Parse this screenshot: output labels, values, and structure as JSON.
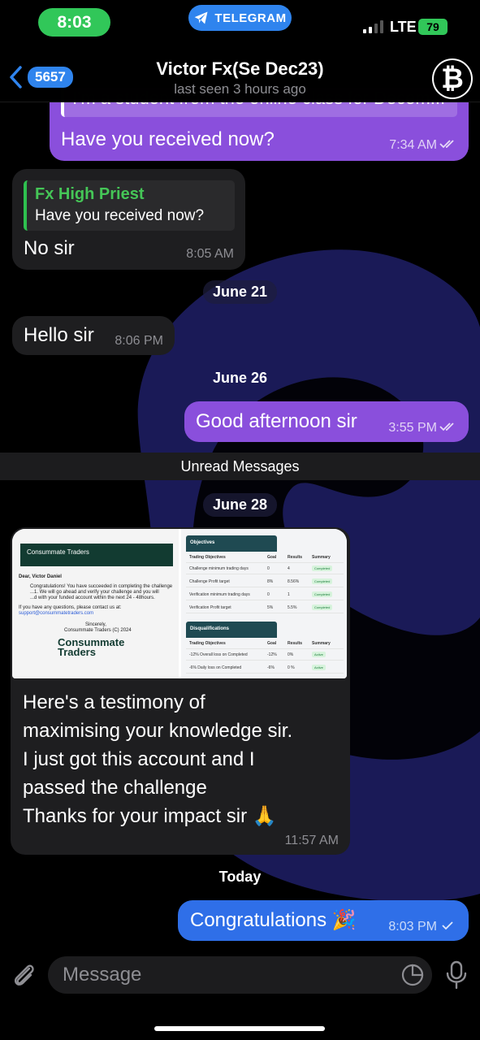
{
  "status_bar": {
    "time": "8:03",
    "app_pill": "TELEGRAM",
    "network": "LTE",
    "battery": "79"
  },
  "header": {
    "back_count": "5657",
    "title": "Victor Fx(Se Dec23)",
    "subtitle": "last seen 3 hours ago",
    "avatar_glyph": "₿"
  },
  "messages": [
    {
      "id": "m1",
      "direction": "out",
      "quoted_partial": "I'm a student from the online class for Decem...",
      "text": "Have you received now?",
      "time": "7:34 AM",
      "read": "double-check"
    },
    {
      "id": "m2",
      "direction": "in",
      "reply_name": "Fx High Priest",
      "reply_text": "Have you received now?",
      "text": "No sir",
      "time": "8:05 AM"
    },
    {
      "id": "m3",
      "direction": "in",
      "text": "Hello sir",
      "time": "8:06 PM"
    },
    {
      "id": "m4",
      "direction": "out",
      "text": "Good afternoon sir",
      "time": "3:55 PM",
      "read": "double-check"
    },
    {
      "id": "m5",
      "direction": "in",
      "text_lines": [
        "Here's a testimony of",
        "maximising your knowledge sir.",
        "I just got this account and I",
        "passed the challenge",
        "Thanks for your impact sir 🙏"
      ],
      "time": "11:57 AM"
    },
    {
      "id": "m6",
      "direction": "out",
      "text": "Congratulations 🎉",
      "time": "8:03 PM",
      "read": "single-check"
    }
  ],
  "dates": {
    "d1": "June 21",
    "d2": "June 26",
    "d3": "June 28",
    "d4": "Today"
  },
  "unread_label": "Unread Messages",
  "photo": {
    "brand": "Consummate Traders",
    "greeting": "Dear, Victor Daniel",
    "body1": "Congratulations! You have succeeded in completing the challenge",
    "body2": "...1. We will go ahead and verify your challenge and you will",
    "body3": "...d with your funded account within the next 24 - 48hours.",
    "body4": "If you have any questions, please contact us at:",
    "email": "support@consummatetraders.com",
    "signoff": "Sincerely,",
    "signoff2": "Consummate Traders (C) 2024",
    "objectives_title": "Objectives",
    "disq_title": "Disqualifications",
    "col_headers": [
      "Trading Objectives",
      "Goal",
      "Results",
      "Summary"
    ],
    "objective_rows": [
      [
        "Challenge minimum trading days",
        "0",
        "4",
        "Completed"
      ],
      [
        "Challenge Profit target",
        "8%",
        "8.56%",
        "Completed"
      ],
      [
        "Verification minimum trading days",
        "0",
        "1",
        "Completed"
      ],
      [
        "Verification Profit target",
        "5%",
        "5.5%",
        "Completed"
      ]
    ],
    "disq_rows": [
      [
        "-12% Overall loss on Completed",
        "-12%",
        "0%",
        "Active"
      ],
      [
        "-6% Daily loss on Completed",
        "-6%",
        "0 %",
        "Active"
      ]
    ]
  },
  "input": {
    "placeholder": "Message"
  },
  "colors": {
    "outgoing": "#8a4fdc",
    "outgoing_latest": "#2f6fe8",
    "incoming": "#1e1e20",
    "accent": "#2f84ee",
    "reply_green": "#45c657"
  }
}
